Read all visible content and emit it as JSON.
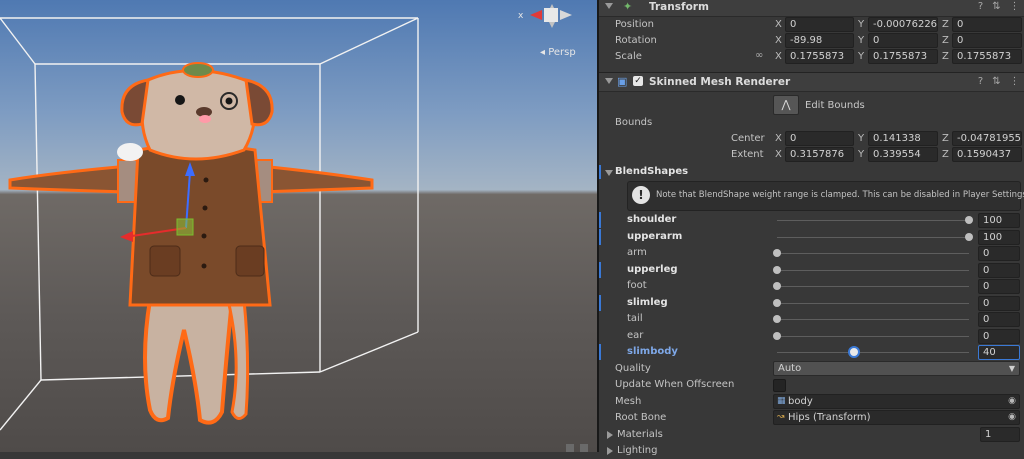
{
  "scene": {
    "view_mode": "Persp",
    "gizmo_x_label": "x"
  },
  "transform": {
    "title": "Transform",
    "position": {
      "label": "Position",
      "x": "0",
      "y": "-0.00076226",
      "z": "0"
    },
    "rotation": {
      "label": "Rotation",
      "x": "-89.98",
      "y": "0",
      "z": "0"
    },
    "scale": {
      "label": "Scale",
      "x": "0.1755873",
      "y": "0.1755873",
      "z": "0.1755873"
    }
  },
  "axes": {
    "x": "X",
    "y": "Y",
    "z": "Z"
  },
  "smr": {
    "title": "Skinned Mesh Renderer",
    "edit_bounds": "Edit Bounds",
    "bounds_label": "Bounds",
    "center": {
      "label": "Center",
      "x": "0",
      "y": "0.141338",
      "z": "-0.04781955"
    },
    "extent": {
      "label": "Extent",
      "x": "0.3157876",
      "y": "0.339554",
      "z": "0.1590437"
    },
    "blendshapes_label": "BlendShapes",
    "note": "Note that BlendShape weight range is clamped. This can be disabled in Player Settings.",
    "blendshapes": [
      {
        "name": "shoulder",
        "value": "100",
        "level": 100
      },
      {
        "name": "upperarm",
        "value": "100",
        "level": 100
      },
      {
        "name": "arm",
        "value": "0",
        "level": 0
      },
      {
        "name": "upperleg",
        "value": "0",
        "level": 0
      },
      {
        "name": "foot",
        "value": "0",
        "level": 0
      },
      {
        "name": "slimleg",
        "value": "0",
        "level": 0
      },
      {
        "name": "tail",
        "value": "0",
        "level": 0
      },
      {
        "name": "ear",
        "value": "0",
        "level": 0
      },
      {
        "name": "slimbody",
        "value": "40",
        "level": 40
      }
    ],
    "quality": {
      "label": "Quality",
      "value": "Auto"
    },
    "update_offscreen": {
      "label": "Update When Offscreen",
      "checked": false
    },
    "mesh": {
      "label": "Mesh",
      "value": "body"
    },
    "root_bone": {
      "label": "Root Bone",
      "value": "Hips (Transform)"
    },
    "materials": {
      "label": "Materials",
      "count": "1"
    },
    "lighting": {
      "label": "Lighting"
    }
  }
}
